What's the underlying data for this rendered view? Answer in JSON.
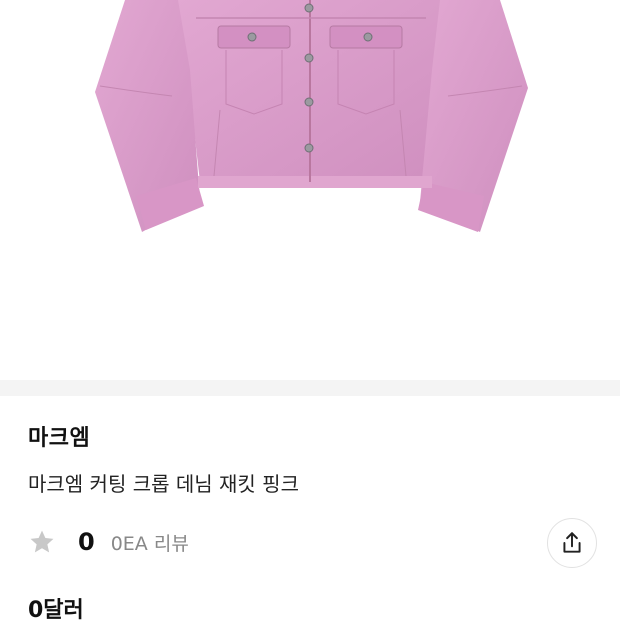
{
  "product": {
    "brand": "마크엠",
    "title": "마크엠 커팅 크롭 데님 재킷 핑크",
    "rating": "0",
    "review_count": "0EA 리뷰",
    "price": "0달러"
  },
  "icons": {
    "rating": "star-icon",
    "share": "share-icon"
  },
  "colors": {
    "jacket_pink": "#d99bc8",
    "star_gray": "#c8c8c8",
    "muted_text": "#888888",
    "separator": "#f4f4f4"
  }
}
